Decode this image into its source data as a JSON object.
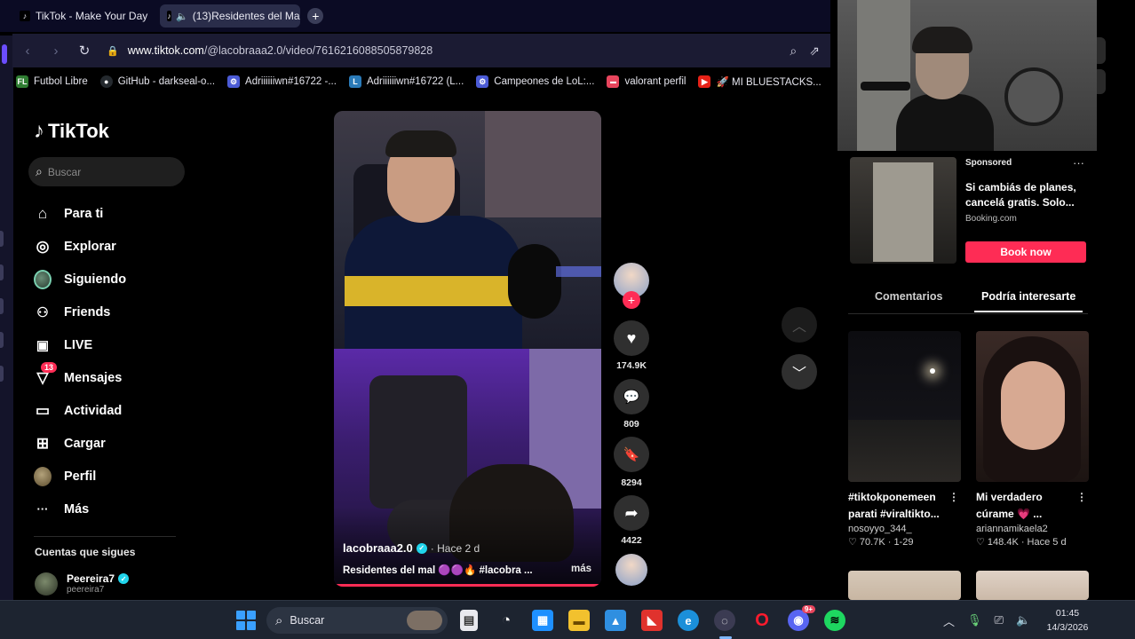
{
  "browser": {
    "tabs": [
      {
        "label": "TikTok - Make Your Day",
        "active": false
      },
      {
        "label": "(13)Residentes del Ma",
        "active": true
      }
    ],
    "new_tab_icon": "plus-icon",
    "url_host": "www.tiktok.com",
    "url_path": "/@lacobraaa2.0/video/7616216088505879828",
    "bookmarks": [
      {
        "label": "Futbol Libre",
        "icon": "FL",
        "color": "#2f7d32"
      },
      {
        "label": "GitHub - darkseal-o...",
        "icon": "GH",
        "color": "#24292e"
      },
      {
        "label": "Adriiiiiiwn#16722 -...",
        "icon": "A",
        "color": "#4b5bd6"
      },
      {
        "label": "Adriiiiiiwn#16722 (L...",
        "icon": "L",
        "color": "#2a7ab8"
      },
      {
        "label": "Campeones de LoL:...",
        "icon": "C",
        "color": "#4b5bd6"
      },
      {
        "label": "valorant perfil",
        "icon": "V",
        "color": "#e8455d"
      },
      {
        "label": "🚀 MI BLUESTACKS...",
        "icon": "▶",
        "color": "#e62117"
      }
    ]
  },
  "tiktok": {
    "logo": "TikTok",
    "search_placeholder": "Buscar",
    "nav": [
      {
        "label": "Para ti",
        "icon": "home-icon",
        "glyph": "⌂"
      },
      {
        "label": "Explorar",
        "icon": "compass-icon",
        "glyph": "◎"
      },
      {
        "label": "Siguiendo",
        "icon": "following-avatar-icon",
        "glyph": ""
      },
      {
        "label": "Friends",
        "icon": "friends-icon",
        "glyph": "👥"
      },
      {
        "label": "LIVE",
        "icon": "live-tv-icon",
        "glyph": "📺"
      },
      {
        "label": "Mensajes",
        "icon": "messages-icon",
        "glyph": "▽",
        "badge": "13"
      },
      {
        "label": "Actividad",
        "icon": "activity-icon",
        "glyph": "▭"
      },
      {
        "label": "Cargar",
        "icon": "upload-icon",
        "glyph": "⊞"
      },
      {
        "label": "Perfil",
        "icon": "profile-avatar-icon",
        "glyph": ""
      },
      {
        "label": "Más",
        "icon": "more-icon",
        "glyph": "···"
      }
    ],
    "following_heading": "Cuentas que sigues",
    "following": [
      {
        "name": "Peereira7",
        "handle": "peereira7",
        "verified": true
      }
    ]
  },
  "video": {
    "username": "lacobraaa2.0",
    "verified": true,
    "posted": "· Hace 2 d",
    "description": "Residentes del mal 🟣🟣🔥 #lacobra ...",
    "more_label": "más",
    "likes": "174.9K",
    "comments": "809",
    "saves": "8294",
    "shares": "4422"
  },
  "right_panel": {
    "sponsor_label": "Sponsored",
    "sponsor_title": "Si cambiás de planes, cancelá gratis. Solo...",
    "sponsor_source": "Booking.com",
    "sponsor_cta": "Book now",
    "tabs": [
      "Comentarios",
      "Podría interesarte"
    ],
    "active_tab": 1,
    "cards": [
      {
        "title": "#tiktokponemeen parati #viraltikto...",
        "author": "nosoyyo_344_",
        "stats": "♡ 70.7K · 1-29"
      },
      {
        "title": "Mi verdadero cúrame 💗 ...",
        "author": "ariannamikaela2",
        "stats": "♡ 148.4K · Hace 5 d"
      }
    ]
  },
  "taskbar": {
    "search_placeholder": "Buscar",
    "time": "01:45",
    "date": "14/3/2026",
    "discord_badge": "9+"
  }
}
